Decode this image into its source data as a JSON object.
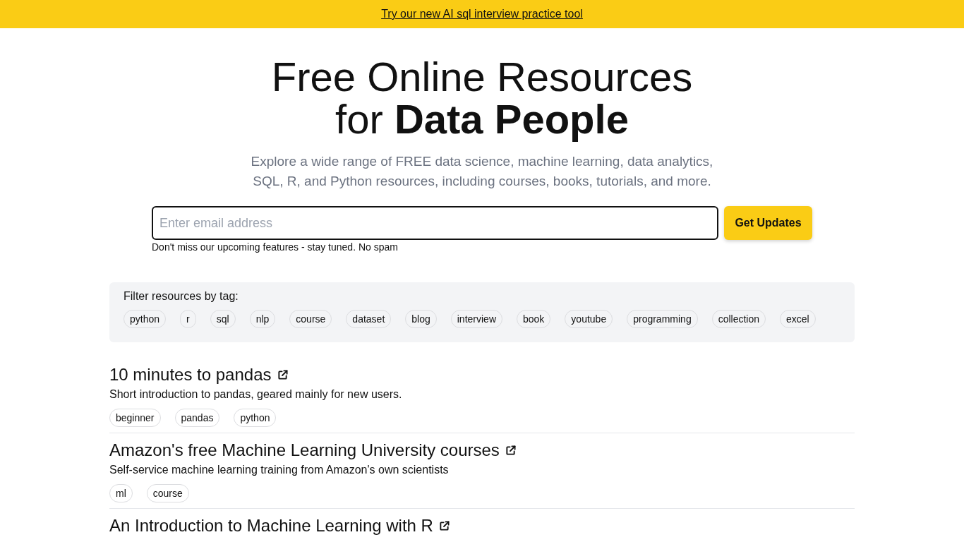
{
  "banner": {
    "link": "Try our new AI sql interview practice tool"
  },
  "hero": {
    "title_lines": [
      "Free Online Resources",
      "for **Data People**"
    ],
    "subtitle": "Explore a wide range of FREE data science, machine learning, data analytics, SQL, R, and Python resources, including courses, books, tutorials, and more."
  },
  "signup": {
    "placeholder": "Enter email address",
    "button": "Get Updates",
    "note": "Don't miss our upcoming features - stay tuned. No spam"
  },
  "tag_filter": {
    "label": "Filter resources by tag:",
    "tags": [
      {
        "label": "python",
        "selected": false
      },
      {
        "label": "r",
        "selected": false
      },
      {
        "label": "sql",
        "selected": false
      },
      {
        "label": "nlp",
        "selected": false
      },
      {
        "label": "course",
        "selected": false
      },
      {
        "label": "dataset",
        "selected": false
      },
      {
        "label": "blog",
        "selected": false
      },
      {
        "label": "interview",
        "selected": false
      },
      {
        "label": "book",
        "selected": false
      },
      {
        "label": "youtube",
        "selected": false
      },
      {
        "label": "programming",
        "selected": false
      },
      {
        "label": "collection",
        "selected": false
      },
      {
        "label": "excel",
        "selected": false
      }
    ]
  },
  "resources": [
    {
      "title": "10 minutes to pandas",
      "description": "Short introduction to pandas, geared mainly for new users.",
      "tags": [
        "beginner",
        "pandas",
        "python"
      ]
    },
    {
      "title": "Amazon's free Machine Learning University courses",
      "description": "Self-service machine learning training from Amazon's own scientists",
      "tags": [
        "ml",
        "course"
      ]
    },
    {
      "title": "An Introduction to Machine Learning with R"
    }
  ]
}
